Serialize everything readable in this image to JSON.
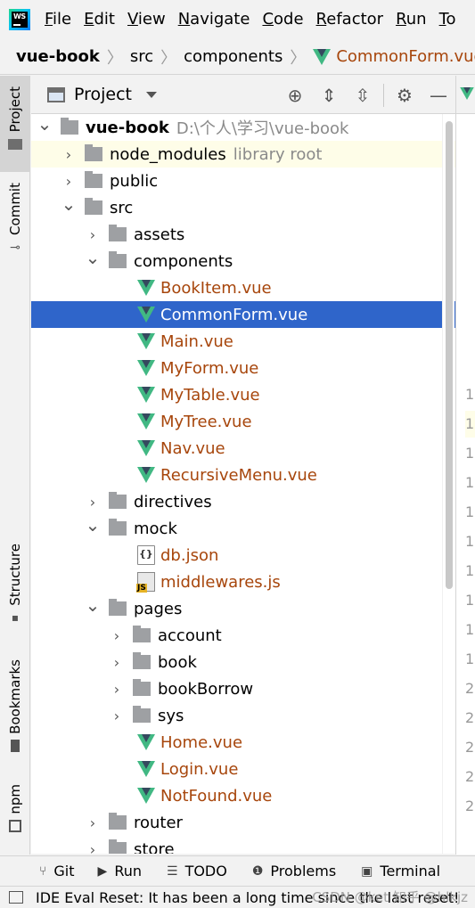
{
  "menubar": {
    "items": [
      {
        "label": "File",
        "mnemonic": "F",
        "rest": "ile"
      },
      {
        "label": "Edit",
        "mnemonic": "E",
        "rest": "dit"
      },
      {
        "label": "View",
        "mnemonic": "V",
        "rest": "iew"
      },
      {
        "label": "Navigate",
        "mnemonic": "N",
        "rest": "avigate"
      },
      {
        "label": "Code",
        "mnemonic": "C",
        "rest": "ode"
      },
      {
        "label": "Refactor",
        "mnemonic": "R",
        "rest": "efactor"
      },
      {
        "label": "Run",
        "mnemonic": "R",
        "rest": "un"
      },
      {
        "label": "To",
        "mnemonic": "T",
        "rest": "o"
      }
    ],
    "logo_text": "WS"
  },
  "breadcrumb": {
    "items": [
      "vue-book",
      "src",
      "components",
      "CommonForm.vue"
    ]
  },
  "leftstrip": {
    "tabs": [
      "Project",
      "Commit",
      "Structure",
      "Bookmarks",
      "npm"
    ]
  },
  "panel": {
    "title": "Project"
  },
  "tree": {
    "rows": [
      {
        "label": "vue-book",
        "secondary": "D:\\个人\\学习\\vue-book",
        "type": "folder",
        "expanded": true
      },
      {
        "label": "node_modules",
        "secondary": "library root",
        "type": "folder",
        "expanded": false
      },
      {
        "label": "public",
        "type": "folder",
        "expanded": false
      },
      {
        "label": "src",
        "type": "folder",
        "expanded": true
      },
      {
        "label": "assets",
        "type": "folder",
        "expanded": false
      },
      {
        "label": "components",
        "type": "folder",
        "expanded": true
      },
      {
        "label": "BookItem.vue",
        "type": "vue"
      },
      {
        "label": "CommonForm.vue",
        "type": "vue",
        "selected": true
      },
      {
        "label": "Main.vue",
        "type": "vue"
      },
      {
        "label": "MyForm.vue",
        "type": "vue"
      },
      {
        "label": "MyTable.vue",
        "type": "vue"
      },
      {
        "label": "MyTree.vue",
        "type": "vue"
      },
      {
        "label": "Nav.vue",
        "type": "vue"
      },
      {
        "label": "RecursiveMenu.vue",
        "type": "vue"
      },
      {
        "label": "directives",
        "type": "folder",
        "expanded": false
      },
      {
        "label": "mock",
        "type": "folder",
        "expanded": true
      },
      {
        "label": "db.json",
        "type": "json"
      },
      {
        "label": "middlewares.js",
        "type": "js"
      },
      {
        "label": "pages",
        "type": "folder",
        "expanded": true
      },
      {
        "label": "account",
        "type": "folder",
        "expanded": false
      },
      {
        "label": "book",
        "type": "folder",
        "expanded": false
      },
      {
        "label": "bookBorrow",
        "type": "folder",
        "expanded": false
      },
      {
        "label": "sys",
        "type": "folder",
        "expanded": false
      },
      {
        "label": "Home.vue",
        "type": "vue"
      },
      {
        "label": "Login.vue",
        "type": "vue"
      },
      {
        "label": "NotFound.vue",
        "type": "vue"
      },
      {
        "label": "router",
        "type": "folder",
        "expanded": false
      },
      {
        "label": "store",
        "type": "folder",
        "expanded": false
      }
    ]
  },
  "editor": {
    "gutter": [
      "1",
      "1",
      "1",
      "1",
      "1",
      "1",
      "1",
      "1",
      "1",
      "1",
      "2",
      "2",
      "2",
      "2",
      "2"
    ]
  },
  "bottombar": {
    "items": [
      "Git",
      "Run",
      "TODO",
      "Problems",
      "Terminal"
    ]
  },
  "statusbar": {
    "message": "IDE Eval Reset: It has been a long time since the last reset!"
  },
  "watermark": "CSDN @ket 知乎 @hlkjz",
  "colors": {
    "selection": "#2f65ca",
    "vue_file": "#a7460c",
    "vue_icon": "#41b883",
    "highlight_row": "#fefde8"
  }
}
